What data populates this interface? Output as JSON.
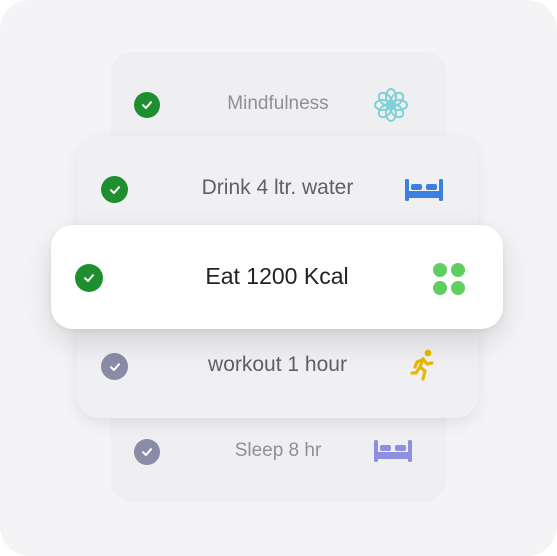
{
  "tasks": [
    {
      "label": "Mindfulness",
      "done": true,
      "icon": "lotus-icon",
      "icon_color": "#7fd1d6"
    },
    {
      "label": "Drink 4 ltr. water",
      "done": true,
      "icon": "bed-icon",
      "icon_color": "#3b7fe0"
    },
    {
      "label": "Eat 1200 Kcal",
      "done": true,
      "icon": "four-dots-icon",
      "icon_color": "#5fcf5f"
    },
    {
      "label": "workout 1 hour",
      "done": false,
      "icon": "running-icon",
      "icon_color": "#e6b800"
    },
    {
      "label": "Sleep 8 hr",
      "done": false,
      "icon": "bed-icon",
      "icon_color": "#8e8fe0"
    }
  ],
  "colors": {
    "check_done": "#1e8e2e",
    "check_pending": "#8a8ba6"
  }
}
